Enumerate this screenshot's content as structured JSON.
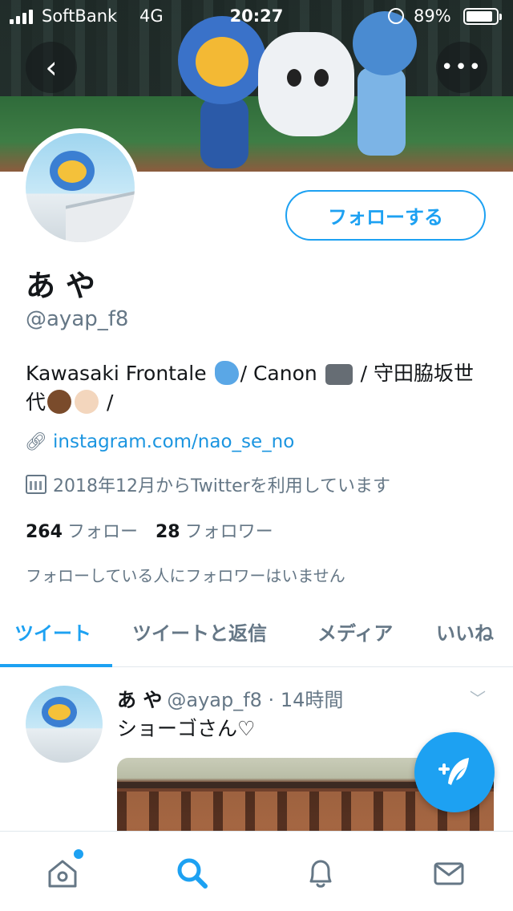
{
  "status_bar": {
    "carrier": "SoftBank",
    "network": "4G",
    "time": "20:27",
    "battery": "89%",
    "battery_level": 0.89
  },
  "header": {
    "back_icon": "chevron-left-icon",
    "more_icon": "ellipsis-icon"
  },
  "profile": {
    "display_name": "あ や",
    "handle": "@ayap_f8",
    "follow_button": "フォローする",
    "bio_part1": "Kawasaki Frontale ",
    "bio_part2": "/ Canon ",
    "bio_part3": " / 守田脇坂世代",
    "bio_part4": " /",
    "link": "instagram.com/nao_se_no",
    "joined": "2018年12月からTwitterを利用しています",
    "following_count": "264",
    "following_label": "フォロー",
    "followers_count": "28",
    "followers_label": "フォロワー",
    "followed_by": "フォローしている人にフォロワーはいません"
  },
  "tabs": [
    {
      "label": "ツイート",
      "active": true
    },
    {
      "label": "ツイートと返信",
      "active": false
    },
    {
      "label": "メディア",
      "active": false
    },
    {
      "label": "いいね",
      "active": false
    }
  ],
  "tweet": {
    "name": "あ や",
    "handle_time": "@ayap_f8 · 14時間",
    "text": "ショーゴさん♡"
  },
  "colors": {
    "accent": "#1da1f2",
    "secondary_text": "#657786"
  }
}
